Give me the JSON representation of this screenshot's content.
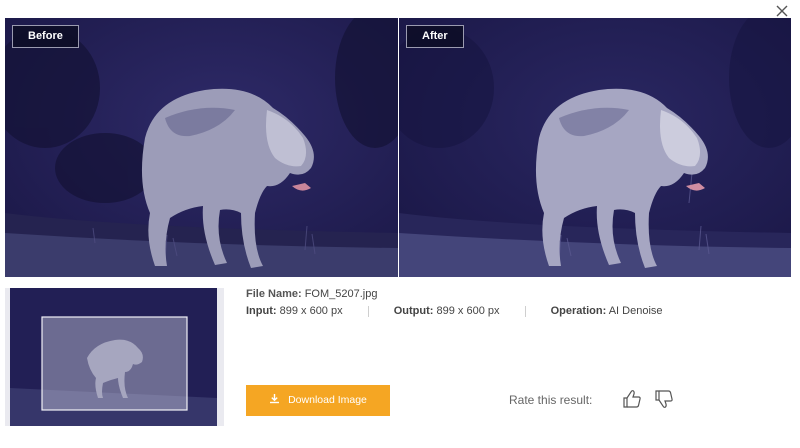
{
  "comparison": {
    "before_label": "Before",
    "after_label": "After"
  },
  "file_info": {
    "file_name_label": "File Name:",
    "file_name": "FOM_5207.jpg",
    "input_label": "Input:",
    "input_value": "899 x 600 px",
    "output_label": "Output:",
    "output_value": "899 x 600 px",
    "operation_label": "Operation:",
    "operation_value": "AI Denoise"
  },
  "actions": {
    "download_label": "Download Image",
    "rate_label": "Rate this result:"
  },
  "icons": {
    "close": "close-icon",
    "download": "download-icon",
    "thumbs_up": "thumbs-up-icon",
    "thumbs_down": "thumbs-down-icon"
  },
  "colors": {
    "download_button": "#f5a623",
    "night_scene": "#2a2660",
    "tag_background": "#0e0e28"
  }
}
